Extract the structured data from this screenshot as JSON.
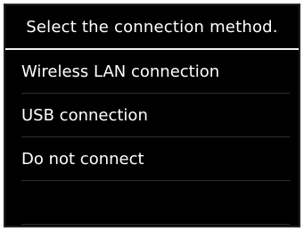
{
  "screen": {
    "title": "Select the connection method.",
    "options": [
      {
        "label": "Wireless LAN connection"
      },
      {
        "label": "USB connection"
      },
      {
        "label": "Do not connect"
      },
      {
        "label": ""
      }
    ]
  },
  "colors": {
    "background": "#000000",
    "text": "#ffffff",
    "divider": "#2e2e2e",
    "title_rule": "#f2f2f2"
  }
}
